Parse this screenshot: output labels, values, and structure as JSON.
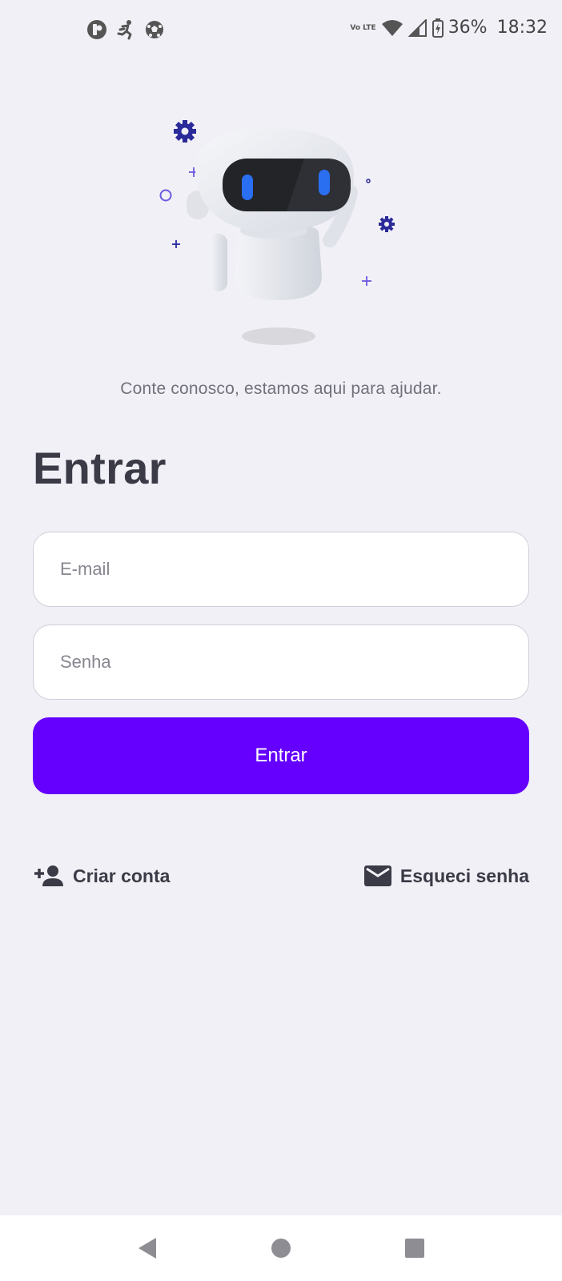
{
  "status_bar": {
    "battery": "36%",
    "time": "18:32",
    "network": "Vo LTE",
    "icons": [
      "app-notification-icon",
      "running-icon",
      "soccer-ball-icon",
      "volte-icon",
      "wifi-icon",
      "signal-icon",
      "battery-charging-icon"
    ]
  },
  "illustration": {
    "icon": "robot-mascot"
  },
  "tagline": "Conte conosco, estamos aqui para ajudar.",
  "login": {
    "title": "Entrar",
    "email_placeholder": "E-mail",
    "password_placeholder": "Senha",
    "submit_label": "Entrar"
  },
  "links": {
    "create_account": "Criar conta",
    "forgot_password": "Esqueci senha"
  },
  "colors": {
    "background": "#f1f0f6",
    "primary": "#6500ff",
    "text": "#3a3b46",
    "muted": "#70717c"
  },
  "nav": {
    "icons": [
      "back-icon",
      "home-icon",
      "recents-icon"
    ]
  }
}
